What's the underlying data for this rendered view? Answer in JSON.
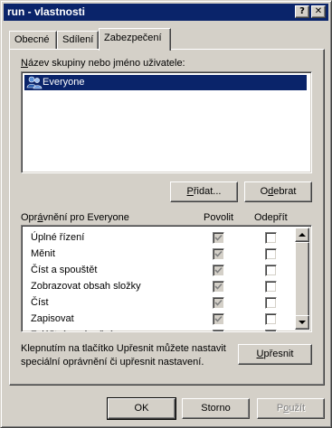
{
  "window": {
    "title": "run - vlastnosti",
    "help_glyph": "?",
    "close_glyph": "✕"
  },
  "tabs": [
    {
      "label": "Obecné",
      "active": false
    },
    {
      "label": "Sdílení",
      "active": false
    },
    {
      "label": "Zabezpečení",
      "active": true
    }
  ],
  "users": {
    "label_mnemonic": "N",
    "label_rest": "ázev skupiny nebo jméno uživatele:",
    "items": [
      {
        "name": "Everyone",
        "icon": "group-icon",
        "selected": true
      }
    ]
  },
  "user_buttons": {
    "add_mnemonic": "P",
    "add_rest": "řidat...",
    "remove_mnemonic": "d",
    "remove_pre": "O",
    "remove_rest": "ebrat"
  },
  "permissions": {
    "header_pre": "Opr",
    "header_mnemonic": "á",
    "header_rest": "vnění pro Everyone",
    "allow_label": "Povolit",
    "deny_label": "Odepřít",
    "rows": [
      {
        "name": "Úplné řízení",
        "allow": true,
        "deny": false
      },
      {
        "name": "Měnit",
        "allow": true,
        "deny": false
      },
      {
        "name": "Číst a spouštět",
        "allow": true,
        "deny": false
      },
      {
        "name": "Zobrazovat obsah složky",
        "allow": true,
        "deny": false
      },
      {
        "name": "Číst",
        "allow": true,
        "deny": false
      },
      {
        "name": "Zapisovat",
        "allow": true,
        "deny": false
      },
      {
        "name": "Zvláštní oprávnění",
        "allow": true,
        "deny": false
      }
    ]
  },
  "advanced": {
    "text_line1": "Klepnutím na tlačítko Upřesnit můžete nastavit",
    "text_line2": "speciální oprávnění či upřesnit nastavení.",
    "button_pre": "U",
    "button_mnemonic": "p",
    "button_rest": "řesnit"
  },
  "footer": {
    "ok_label": "OK",
    "cancel_label": "Storno",
    "apply_pre": "P",
    "apply_mnemonic": "o",
    "apply_rest": "užít"
  },
  "colors": {
    "titlebar": "#0a246a",
    "selection": "#0a246a",
    "face": "#d4d0c8"
  }
}
